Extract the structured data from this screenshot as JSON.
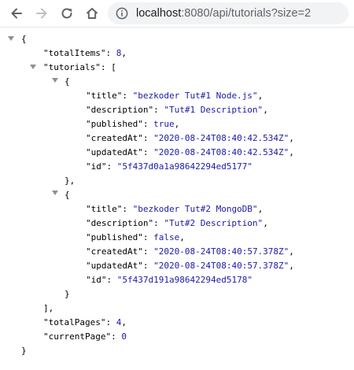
{
  "browser": {
    "url_host": "localhost",
    "url_rest": ":8080/api/tutorials?size=2"
  },
  "json": {
    "brace_open": "{",
    "brace_close": "}",
    "totalItems_key": "\"totalItems\"",
    "totalItems_value": "8",
    "tutorials_key": "\"tutorials\"",
    "array_open": "[",
    "array_close": "],",
    "items": [
      {
        "open": "{",
        "close": "},",
        "title_key": "\"title\"",
        "title": "\"bezkoder Tut#1 Node.js\"",
        "description_key": "\"description\"",
        "description": "\"Tut#1 Description\"",
        "published_key": "\"published\"",
        "published": "true",
        "createdAt_key": "\"createdAt\"",
        "createdAt": "\"2020-08-24T08:40:42.534Z\"",
        "updatedAt_key": "\"updatedAt\"",
        "updatedAt": "\"2020-08-24T08:40:42.534Z\"",
        "id_key": "\"id\"",
        "id": "\"5f437d0a1a98642294ed5177\""
      },
      {
        "open": "{",
        "close": "}",
        "title_key": "\"title\"",
        "title": "\"bezkoder Tut#2 MongoDB\"",
        "description_key": "\"description\"",
        "description": "\"Tut#2 Description\"",
        "published_key": "\"published\"",
        "published": "false",
        "createdAt_key": "\"createdAt\"",
        "createdAt": "\"2020-08-24T08:40:57.378Z\"",
        "updatedAt_key": "\"updatedAt\"",
        "updatedAt": "\"2020-08-24T08:40:57.378Z\"",
        "id_key": "\"id\"",
        "id": "\"5f437d191a98642294ed5178\""
      }
    ],
    "totalPages_key": "\"totalPages\"",
    "totalPages_value": "4",
    "currentPage_key": "\"currentPage\"",
    "currentPage_value": "0"
  },
  "colors": {
    "string_value": "#1a1aa6",
    "key": "#000000",
    "toggle": "#909090"
  }
}
